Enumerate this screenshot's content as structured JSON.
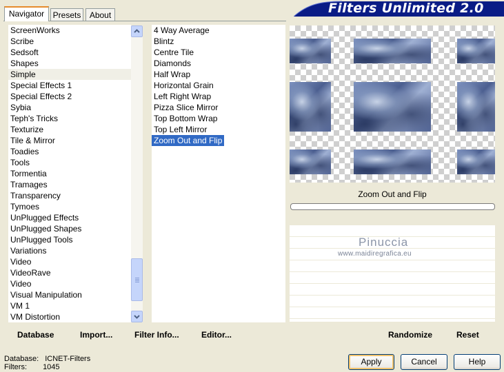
{
  "tabs": [
    "Navigator",
    "Presets",
    "About"
  ],
  "title": "Filters Unlimited 2.0",
  "categories": [
    "ScreenWorks",
    "Scribe",
    "Sedsoft",
    "Shapes",
    "Simple",
    "Special Effects 1",
    "Special Effects 2",
    "Sybia",
    "Teph's Tricks",
    "Texturize",
    "Tile & Mirror",
    "Toadies",
    "Tools",
    "Tormentia",
    "Tramages",
    "Transparency",
    "Tymoes",
    "UnPlugged Effects",
    "UnPlugged Shapes",
    "UnPlugged Tools",
    "Variations",
    "Video",
    "VideoRave",
    "Video",
    "Visual Manipulation",
    "VM 1",
    "VM Distortion"
  ],
  "selected_category": "Simple",
  "filters": [
    "4 Way Average",
    "Blintz",
    "Centre Tile",
    "Diamonds",
    "Half Wrap",
    "Horizontal Grain",
    "Left Right Wrap",
    "Pizza Slice Mirror",
    "Top Bottom Wrap",
    "Top Left Mirror",
    "Zoom Out and Flip"
  ],
  "selected_filter": "Zoom Out and Flip",
  "toolbar": {
    "database": "Database",
    "import": "Import...",
    "filter_info": "Filter Info...",
    "editor": "Editor..."
  },
  "preview": {
    "filter_name": "Zoom Out and Flip",
    "randomize": "Randomize",
    "reset": "Reset"
  },
  "watermark": {
    "name": "Pinuccia",
    "url": "www.maidiregrafica.eu"
  },
  "status": {
    "database_label": "Database:",
    "database_value": "ICNET-Filters",
    "filters_label": "Filters:",
    "filters_value": "1045"
  },
  "buttons": {
    "apply": "Apply",
    "cancel": "Cancel",
    "help": "Help"
  },
  "colors": {
    "selection": "#316ac5",
    "banner": "#0a1c86",
    "tab_accent": "#e68b2c",
    "background": "#ece9d8"
  }
}
